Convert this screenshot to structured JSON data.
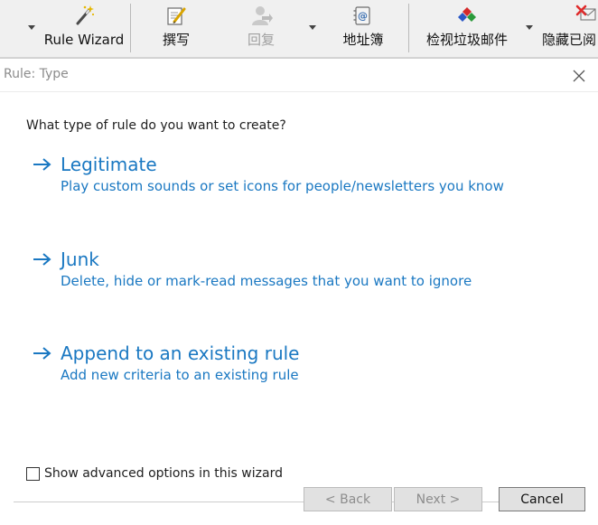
{
  "toolbar": {
    "rule_wizard_label": "Rule Wizard",
    "compose_label": "撰写",
    "reply_label": "回复",
    "address_book_label": "地址簿",
    "check_spam_label": "检视垃圾邮件",
    "hide_read_label": "隐藏已阅"
  },
  "dialog": {
    "title": "Rule: Type",
    "question": "What type of rule do you want to create?",
    "options": [
      {
        "title": "Legitimate",
        "description": "Play custom sounds or set icons for people/newsletters you know"
      },
      {
        "title": "Junk",
        "description": "Delete, hide or mark-read messages that you want to ignore"
      },
      {
        "title": "Append to an existing rule",
        "description": "Add new criteria to an existing rule"
      }
    ],
    "advanced_label": "Show advanced options in this wizard",
    "advanced_checked": false,
    "back_label": "< Back",
    "next_label": "Next >",
    "cancel_label": "Cancel"
  },
  "colors": {
    "link_blue": "#1a78c2",
    "toolbar_bg": "#f0f0f0"
  }
}
